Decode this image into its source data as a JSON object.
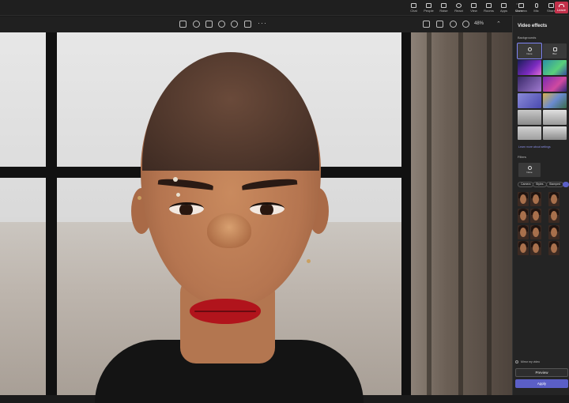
{
  "topbar": {
    "items": [
      {
        "label": "Chat",
        "icon": "chat-icon"
      },
      {
        "label": "People",
        "icon": "people-icon"
      },
      {
        "label": "Raise",
        "icon": "raise-hand-icon"
      },
      {
        "label": "React",
        "icon": "react-icon"
      },
      {
        "label": "View",
        "icon": "view-icon"
      },
      {
        "label": "Rooms",
        "icon": "rooms-icon"
      },
      {
        "label": "Apps",
        "icon": "apps-icon"
      },
      {
        "label": "More",
        "icon": "more-icon"
      }
    ],
    "media": [
      {
        "label": "Camera",
        "icon": "camera-icon"
      },
      {
        "label": "Mic",
        "icon": "mic-icon"
      },
      {
        "label": "Share",
        "icon": "share-icon"
      }
    ],
    "leave_label": "Leave",
    "leave_color": "#c4314b"
  },
  "toolbar": {
    "tools": [
      "edit-icon",
      "rotate-icon",
      "delete-icon",
      "heart-icon",
      "info-icon",
      "crop-icon"
    ],
    "zoom": "48%"
  },
  "panel": {
    "title": "Video effects",
    "backgrounds_label": "Backgrounds",
    "none_label": "None",
    "blur_label": "Blur",
    "more_link": "Learn more about settings",
    "filters_label": "Filters",
    "filters_none_label": "None",
    "filter_chips": [
      "Camera",
      "Styles",
      "Stamped",
      "Mic"
    ],
    "mirror_label": "Mirror my video",
    "preview_label": "Preview",
    "apply_label": "Apply",
    "accent": "#5b5fc7"
  }
}
